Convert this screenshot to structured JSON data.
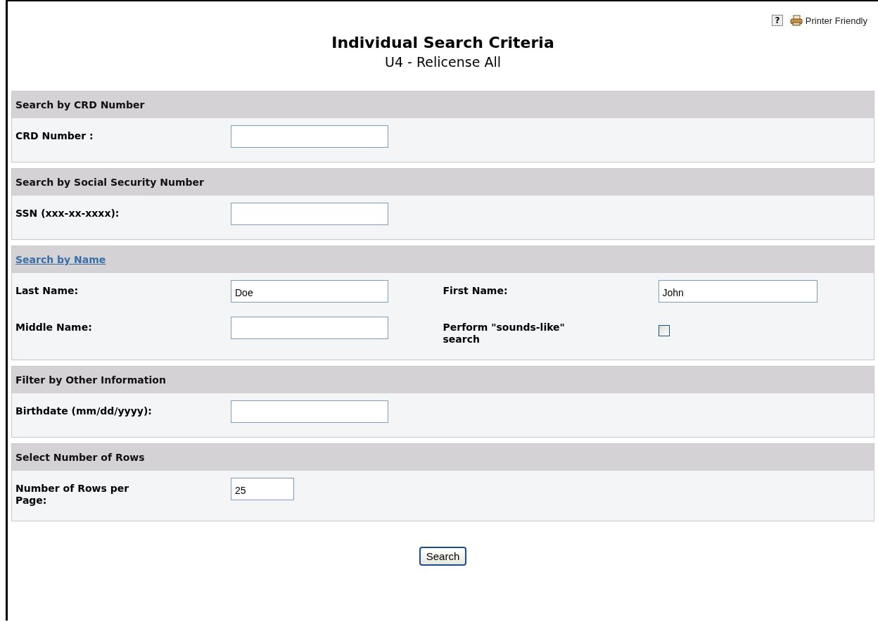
{
  "toolbar": {
    "help": "?",
    "printer": "Printer Friendly"
  },
  "title": "Individual Search Criteria",
  "subtitle": "U4 -  Relicense All",
  "sections": [
    {
      "heading": "Search by CRD Number",
      "kind": "plain",
      "rows": [
        [
          {
            "kind": "text",
            "label": "CRD Number :"
          }
        ]
      ]
    },
    {
      "heading": "Search by Social Security Number",
      "kind": "plain",
      "rows": [
        [
          {
            "kind": "text",
            "label": "SSN (xxx-xx-xxxx):"
          }
        ]
      ]
    },
    {
      "heading": "Search by Name",
      "kind": "link",
      "rows": [
        [
          {
            "kind": "text",
            "label": "Last Name:",
            "value": "Doe"
          },
          {
            "kind": "text",
            "label": "First Name:",
            "value": "John"
          }
        ],
        [
          {
            "kind": "text",
            "label": "Middle Name:"
          },
          {
            "kind": "checkbox",
            "label": "Perform \"sounds-like\" search",
            "checked": false
          }
        ]
      ]
    },
    {
      "heading": "Filter by Other Information",
      "kind": "plain",
      "rows": [
        [
          {
            "kind": "text",
            "label": "Birthdate (mm/dd/yyyy):"
          }
        ]
      ]
    },
    {
      "heading": "Select Number of Rows",
      "kind": "plain",
      "rows": [
        [
          {
            "kind": "short",
            "label": "Number of Rows per Page:",
            "value": "25"
          }
        ]
      ]
    }
  ],
  "button": "Search"
}
